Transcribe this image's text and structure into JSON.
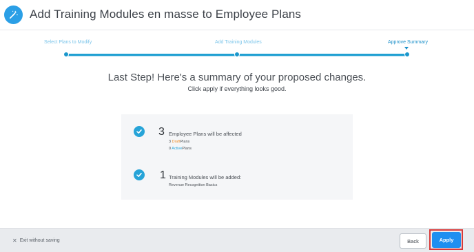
{
  "header": {
    "title": "Add Training Modules en masse to Employee Plans",
    "logo_icon": "magic-wand-icon"
  },
  "stepper": {
    "steps": [
      {
        "label": "Select Plans to Modify"
      },
      {
        "label": "Add Training Modules"
      },
      {
        "label": "Approve Summary"
      }
    ],
    "active_step": 3
  },
  "summary": {
    "heading": "Last Step! Here's a summary of your proposed changes.",
    "subheading": "Click apply if everything looks good.",
    "plans": {
      "count": "3",
      "title": "Employee Plans will be affected",
      "draft_count": "3",
      "draft_label": "Draft",
      "draft_suffix": "Plans",
      "active_count": "0",
      "active_label": "Active",
      "active_suffix": "Plans"
    },
    "modules": {
      "count": "1",
      "title": "Training Modules will be added:",
      "item": "Revenue Recognition Basics"
    }
  },
  "footer": {
    "exit_label": "Exit without saving",
    "back_label": "Back",
    "apply_label": "Apply"
  },
  "colors": {
    "accent": "#1e8ff0",
    "step_track": "#21a0d2",
    "draft": "#f0922f",
    "highlight_outline": "#d93a3a"
  }
}
